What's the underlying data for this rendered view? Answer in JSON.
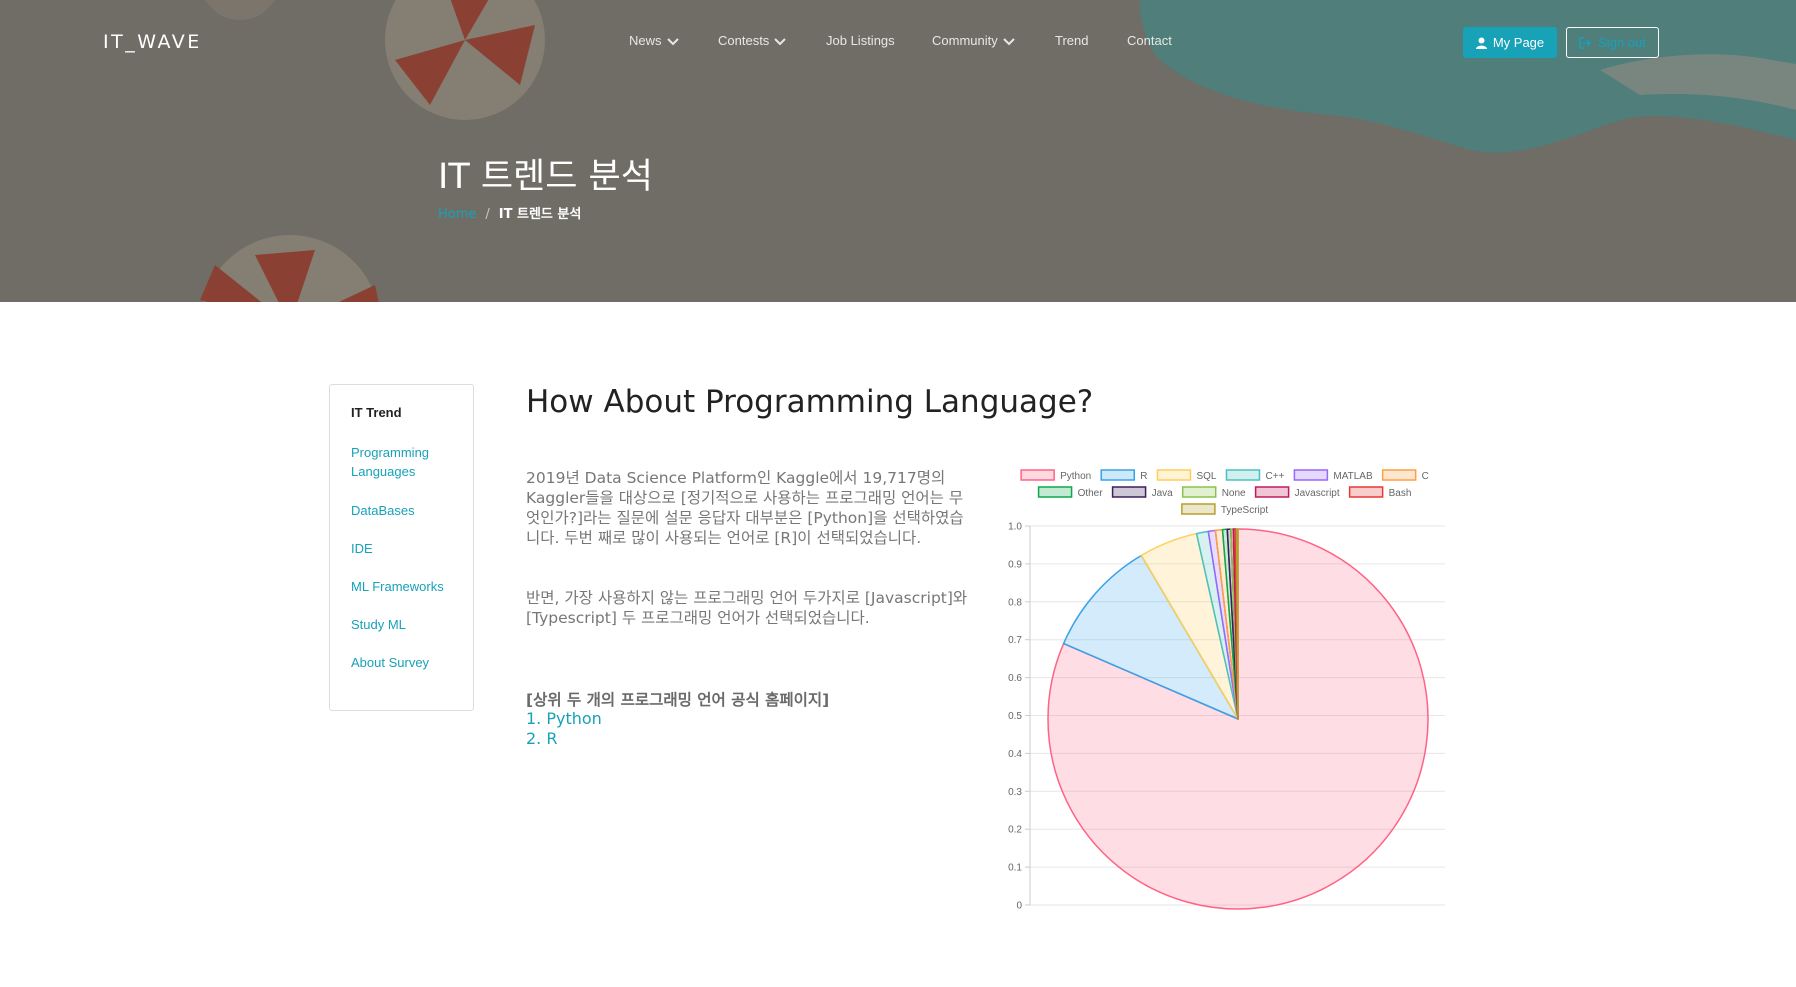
{
  "header": {
    "logo": "IT_WAVE",
    "nav": [
      {
        "label": "News",
        "dropdown": true
      },
      {
        "label": "Contests",
        "dropdown": true
      },
      {
        "label": "Job Listings",
        "dropdown": false
      },
      {
        "label": "Community",
        "dropdown": true
      },
      {
        "label": "Trend",
        "dropdown": false
      },
      {
        "label": "Contact",
        "dropdown": false
      }
    ],
    "my_page_label": "My Page",
    "my_page_icon": "user-icon",
    "sign_out_label": "Sign out",
    "sign_out_icon": "sign-out-icon"
  },
  "hero": {
    "title": "IT 트렌드 분석",
    "breadcrumb": {
      "home": "Home",
      "separator": "/",
      "current": "IT 트렌드 분석"
    }
  },
  "sidebar": {
    "heading": "IT Trend",
    "items": [
      "Programming Languages",
      "DataBases",
      "IDE",
      "ML Frameworks",
      "Study ML",
      "About Survey"
    ]
  },
  "main": {
    "title": "How About Programming Language?",
    "paragraph1": "2019년 Data Science Platform인 Kaggle에서 19,717명의 Kaggler들을 대상으로 [정기적으로 사용하는 프로그래밍 언어는 무엇인가?]라는 질문에 설문 응답자 대부분은 [Python]을 선택하였습니다. 두번 째로 많이 사용되는 언어로 [R]이 선택되었습니다.",
    "paragraph2": "반면, 가장 사용하지 않는 프로그래밍 언어 두가지로 [Javascript]와 [Typescript] 두 프로그래밍 언어가 선택되었습니다.",
    "links_heading": "[상위 두 개의 프로그래밍 언어 공식 홈페이지]",
    "links": [
      "1. Python",
      "2. R"
    ]
  },
  "chart_data": {
    "type": "pie",
    "categories": [
      "Python",
      "R",
      "SQL",
      "C++",
      "MATLAB",
      "C",
      "Other",
      "Java",
      "None",
      "Javascript",
      "Bash",
      "TypeScript"
    ],
    "values": [
      0.815,
      0.1,
      0.05,
      0.01,
      0.006,
      0.006,
      0.004,
      0.003,
      0.002,
      0.0015,
      0.0013,
      0.0012
    ],
    "colors": [
      "#ff6384",
      "#36a2eb",
      "#ffce56",
      "#4bc0c0",
      "#9966ff",
      "#ff9f40",
      "#0ca84a",
      "#3b1e5a",
      "#8bc34a",
      "#c2185b",
      "#e53935",
      "#b5a12a"
    ],
    "yticks": [
      "1.0",
      "0.9",
      "0.8",
      "0.7",
      "0.6",
      "0.5",
      "0.4",
      "0.3",
      "0.2",
      "0.1",
      "0"
    ],
    "ylim": [
      0,
      1.0
    ],
    "grid": true,
    "legend_position": "top"
  }
}
